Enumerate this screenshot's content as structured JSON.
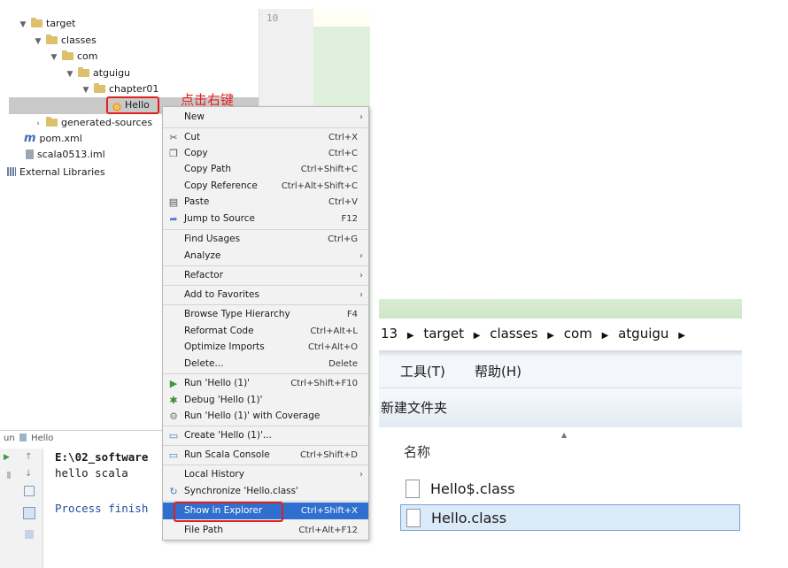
{
  "editor": {
    "line_number": "10"
  },
  "tree": {
    "target": "target",
    "classes": "classes",
    "com": "com",
    "atguigu": "atguigu",
    "chapter": "chapter01",
    "hello": "Hello",
    "generated": "generated-sources",
    "pom": "pom.xml",
    "iml": "scala0513.iml",
    "libs": "External Libraries"
  },
  "annotation": {
    "right_click": "点击右键"
  },
  "menu": {
    "new": "New",
    "cut": "Cut",
    "cut_sc": "Ctrl+X",
    "copy": "Copy",
    "copy_sc": "Ctrl+C",
    "copy_path": "Copy Path",
    "copy_path_sc": "Ctrl+Shift+C",
    "copy_ref": "Copy Reference",
    "copy_ref_sc": "Ctrl+Alt+Shift+C",
    "paste": "Paste",
    "paste_sc": "Ctrl+V",
    "jump": "Jump to Source",
    "jump_sc": "F12",
    "find": "Find Usages",
    "find_sc": "Ctrl+G",
    "analyze": "Analyze",
    "refactor": "Refactor",
    "favorites": "Add to Favorites",
    "browse": "Browse Type Hierarchy",
    "browse_sc": "F4",
    "reformat": "Reformat Code",
    "reformat_sc": "Ctrl+Alt+L",
    "optimize": "Optimize Imports",
    "optimize_sc": "Ctrl+Alt+O",
    "delete": "Delete...",
    "delete_sc": "Delete",
    "run": "Run 'Hello (1)'",
    "run_sc": "Ctrl+Shift+F10",
    "debug": "Debug 'Hello (1)'",
    "coverage": "Run 'Hello (1)' with Coverage",
    "create": "Create 'Hello (1)'...",
    "scala_console": "Run Scala Console",
    "scala_console_sc": "Ctrl+Shift+D",
    "local_history": "Local History",
    "sync": "Synchronize 'Hello.class'",
    "show_explorer": "Show in Explorer",
    "show_explorer_sc": "Ctrl+Shift+X",
    "file_path": "File Path",
    "file_path_sc": "Ctrl+Alt+F12"
  },
  "run_panel": {
    "tab_label": "un",
    "tab_file": "Hello",
    "line1": "E:\\02_software",
    "line2": "hello scala",
    "line3": "Process finish"
  },
  "explorer": {
    "breadcrumb": [
      "13",
      "target",
      "classes",
      "com",
      "atguigu"
    ],
    "menu_tools": "工具(T)",
    "menu_help": "帮助(H)",
    "new_folder": "新建文件夹",
    "col_name": "名称",
    "files": [
      "Hello$.class",
      "Hello.class"
    ]
  }
}
